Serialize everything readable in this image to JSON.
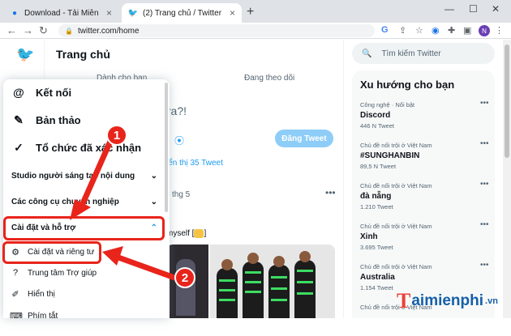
{
  "browser": {
    "tab_inactive": "Download - Tải Miễn Phí VN - Ph",
    "tab_active": "(2) Trang chủ / Twitter",
    "url": "twitter.com/home",
    "profile_initial": "N"
  },
  "main": {
    "title": "Trang chủ",
    "tab_for_you": "Dành cho bạn",
    "tab_following": "Đang theo dõi",
    "compose_placeholder_fragment": "y ra?!",
    "tweet_button": "Đăng Tweet",
    "show_tweets": "iển thị 35 Tweet",
    "tweet_date": "thg 5",
    "tweet_text": "myself [",
    "tweet_text_end": "]"
  },
  "search": {
    "placeholder": "Tìm kiếm Twitter"
  },
  "trends": {
    "title": "Xu hướng cho bạn",
    "items": [
      {
        "category": "Công nghệ · Nổi bật",
        "name": "Discord",
        "count": "446 N Tweet"
      },
      {
        "category": "Chủ đề nổi trội ở Việt Nam",
        "name": "#SUNGHANBIN",
        "count": "89,5 N Tweet"
      },
      {
        "category": "Chủ đề nổi trội ở Việt Nam",
        "name": "đà nẵng",
        "count": "1.210 Tweet"
      },
      {
        "category": "Chủ đề nổi trội ở Việt Nam",
        "name": "Xinh",
        "count": "3.695 Tweet"
      },
      {
        "category": "Chủ đề nổi trội ở Việt Nam",
        "name": "Australia",
        "count": "1.154 Tweet"
      },
      {
        "category": "Chủ đề nổi trội ở Việt Nam",
        "name": "",
        "count": ""
      }
    ]
  },
  "menu": {
    "connect": "Kết nối",
    "drafts": "Bản thảo",
    "verified_orgs": "Tổ chức đã xác nhận",
    "creator_studio": "Studio người sáng tạo nội dung",
    "pro_tools": "Các công cụ chuyên nghiệp",
    "settings_support": "Cài đặt và hỗ trợ",
    "settings_privacy": "Cài đặt và riêng tư",
    "help_center": "Trung tâm Trợ giúp",
    "display": "Hiển thị",
    "shortcuts": "Phím tắt"
  },
  "annotations": {
    "step1": "1",
    "step2": "2",
    "color": "#e8241b"
  },
  "watermark": {
    "brand": "aimienphi",
    "brand_initial": "T",
    "suffix": ".vn"
  }
}
